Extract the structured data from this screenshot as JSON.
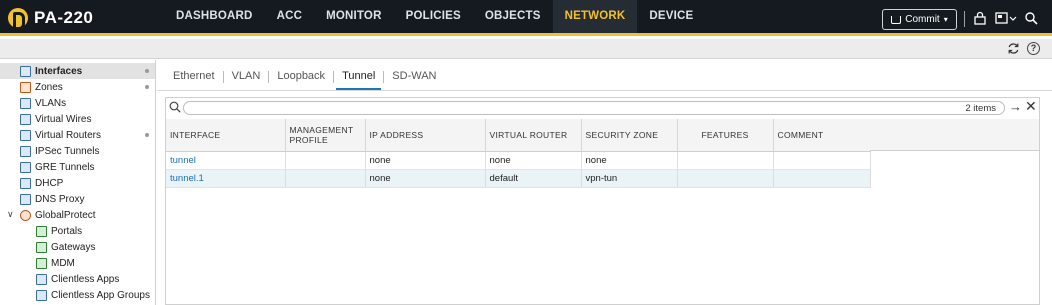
{
  "app": {
    "title": "PA-220"
  },
  "nav": {
    "items": [
      {
        "label": "DASHBOARD",
        "active": false
      },
      {
        "label": "ACC",
        "active": false
      },
      {
        "label": "MONITOR",
        "active": false
      },
      {
        "label": "POLICIES",
        "active": false
      },
      {
        "label": "OBJECTS",
        "active": false
      },
      {
        "label": "NETWORK",
        "active": true
      },
      {
        "label": "DEVICE",
        "active": false
      }
    ],
    "commit_label": "Commit",
    "accent": "#f2c12e"
  },
  "sidebar": {
    "items": [
      {
        "label": "Interfaces",
        "icon": "interfaces-icon",
        "selected": true,
        "dot": true
      },
      {
        "label": "Zones",
        "icon": "zones-icon",
        "selected": false,
        "dot": true
      },
      {
        "label": "VLANs",
        "icon": "vlans-icon",
        "selected": false,
        "dot": false
      },
      {
        "label": "Virtual Wires",
        "icon": "virtual-wires-icon",
        "selected": false,
        "dot": false
      },
      {
        "label": "Virtual Routers",
        "icon": "virtual-routers-icon",
        "selected": false,
        "dot": true
      },
      {
        "label": "IPSec Tunnels",
        "icon": "ipsec-tunnels-icon",
        "selected": false,
        "dot": false
      },
      {
        "label": "GRE Tunnels",
        "icon": "gre-tunnels-icon",
        "selected": false,
        "dot": false
      },
      {
        "label": "DHCP",
        "icon": "dhcp-icon",
        "selected": false,
        "dot": false
      },
      {
        "label": "DNS Proxy",
        "icon": "dns-proxy-icon",
        "selected": false,
        "dot": false
      },
      {
        "label": "GlobalProtect",
        "icon": "globalprotect-icon",
        "selected": false,
        "dot": false,
        "expanded": true
      },
      {
        "label": "Portals",
        "icon": "portals-icon",
        "selected": false,
        "dot": false,
        "child": true
      },
      {
        "label": "Gateways",
        "icon": "gateways-icon",
        "selected": false,
        "dot": false,
        "child": true
      },
      {
        "label": "MDM",
        "icon": "mdm-icon",
        "selected": false,
        "dot": false,
        "child": true
      },
      {
        "label": "Clientless Apps",
        "icon": "clientless-apps-icon",
        "selected": false,
        "dot": false,
        "child": true
      },
      {
        "label": "Clientless App Groups",
        "icon": "clientless-app-groups-icon",
        "selected": false,
        "dot": false,
        "child": true
      }
    ]
  },
  "tabs": [
    {
      "label": "Ethernet",
      "active": false
    },
    {
      "label": "VLAN",
      "active": false
    },
    {
      "label": "Loopback",
      "active": false
    },
    {
      "label": "Tunnel",
      "active": true
    },
    {
      "label": "SD-WAN",
      "active": false
    }
  ],
  "search": {
    "value": "",
    "placeholder": "",
    "items_count": "2 items"
  },
  "table": {
    "columns": [
      "INTERFACE",
      "MANAGEMENT PROFILE",
      "IP ADDRESS",
      "VIRTUAL ROUTER",
      "SECURITY ZONE",
      "FEATURES",
      "COMMENT"
    ],
    "rows": [
      {
        "interface": "tunnel",
        "management_profile": "",
        "ip_address": "none",
        "virtual_router": "none",
        "security_zone": "none",
        "features": "",
        "comment": ""
      },
      {
        "interface": "tunnel.1",
        "management_profile": "",
        "ip_address": "none",
        "virtual_router": "default",
        "security_zone": "vpn-tun",
        "features": "",
        "comment": ""
      }
    ]
  }
}
